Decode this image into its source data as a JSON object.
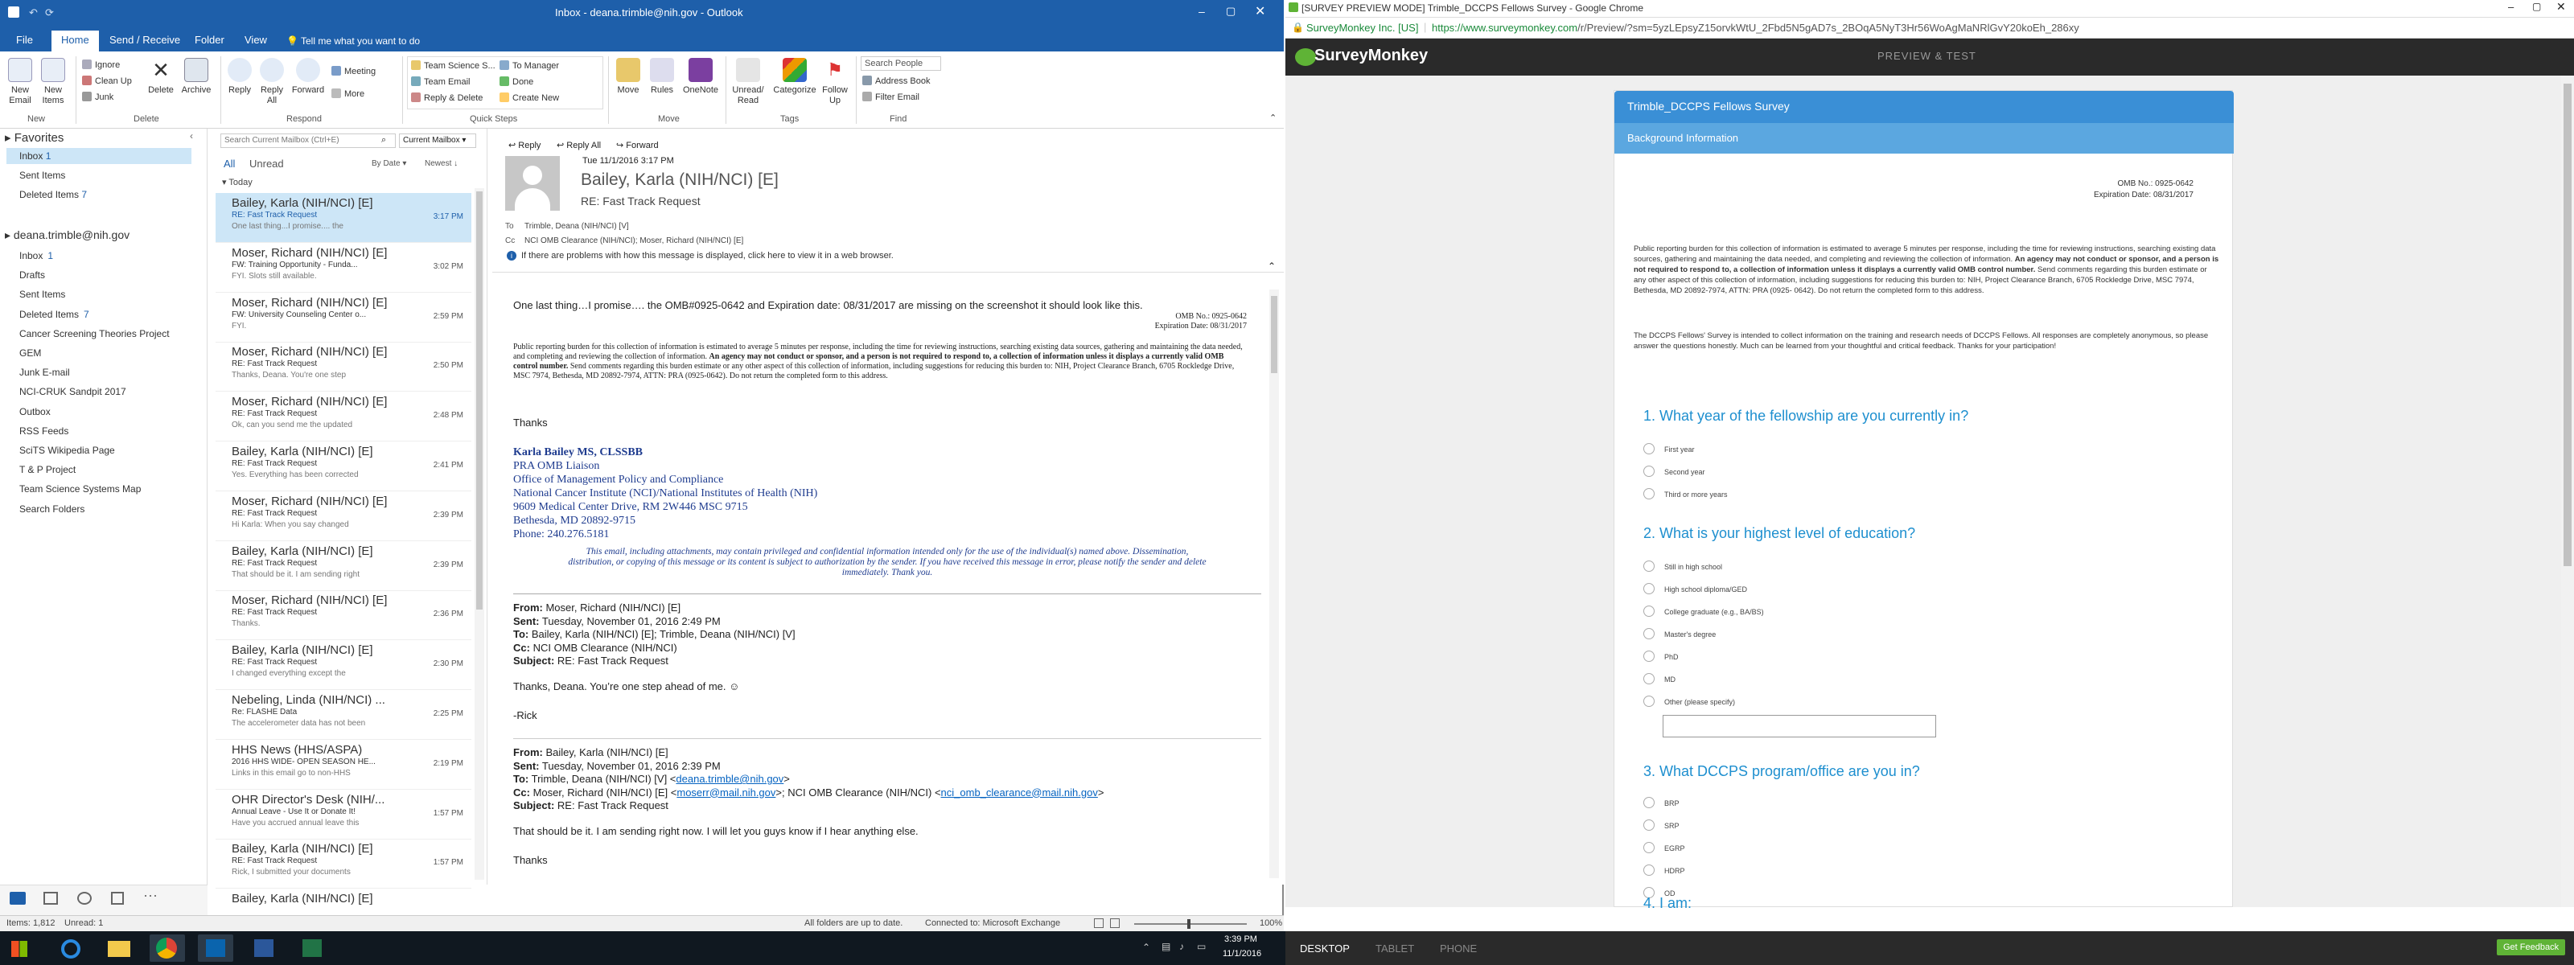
{
  "outlook": {
    "title": "Inbox - deana.trimble@nih.gov - Outlook",
    "tabs": [
      "File",
      "Home",
      "Send / Receive",
      "Folder",
      "View"
    ],
    "tellme": "Tell me what you want to do",
    "ribbon": {
      "new_email": "New Email",
      "new_items": "New Items",
      "ignore": "Ignore",
      "cleanup": "Clean Up",
      "junk": "Junk",
      "delete": "Delete",
      "archive": "Archive",
      "reply": "Reply",
      "reply_all": "Reply All",
      "forward": "Forward",
      "meeting": "Meeting",
      "more": "More",
      "qs1": "Team Science S...",
      "qs2": "Team Email",
      "qs3": "Reply & Delete",
      "qs4": "To Manager",
      "qs5": "Done",
      "qs6": "Create New",
      "move": "Move",
      "rules": "Rules",
      "onenote": "OneNote",
      "unread_read": "Unread/ Read",
      "categorize": "Categorize",
      "follow_up": "Follow Up",
      "search_people": "Search People",
      "address_book": "Address Book",
      "filter_email": "Filter Email",
      "groups": [
        "New",
        "Delete",
        "Respond",
        "Quick Steps",
        "Move",
        "Tags",
        "Find"
      ]
    },
    "favorites": {
      "header": "Favorites",
      "items": [
        {
          "label": "Inbox",
          "count": "1"
        },
        {
          "label": "Sent Items",
          "count": ""
        },
        {
          "label": "Deleted Items",
          "count": "7"
        }
      ]
    },
    "account": "deana.trimble@nih.gov",
    "folders": [
      {
        "label": "Inbox",
        "count": "1"
      },
      {
        "label": "Drafts",
        "count": ""
      },
      {
        "label": "Sent Items",
        "count": ""
      },
      {
        "label": "Deleted Items",
        "count": "7"
      },
      {
        "label": "Cancer Screening Theories Project",
        "count": ""
      },
      {
        "label": "GEM",
        "count": ""
      },
      {
        "label": "Junk E-mail",
        "count": ""
      },
      {
        "label": "NCI-CRUK Sandpit 2017",
        "count": ""
      },
      {
        "label": "Outbox",
        "count": ""
      },
      {
        "label": "RSS Feeds",
        "count": ""
      },
      {
        "label": "SciTS Wikipedia Page",
        "count": ""
      },
      {
        "label": "T & P Project",
        "count": ""
      },
      {
        "label": "Team Science Systems Map",
        "count": ""
      },
      {
        "label": "Search Folders",
        "count": ""
      }
    ],
    "search_placeholder": "Search Current Mailbox (Ctrl+E)",
    "scope": "Current Mailbox",
    "filter_all": "All",
    "filter_unread": "Unread",
    "sort_by": "By Date",
    "sort_order": "Newest",
    "group_today": "Today",
    "messages": [
      {
        "from": "Bailey, Karla (NIH/NCI) [E]",
        "subject": "RE: Fast Track Request",
        "preview": "One last thing...I promise.... the",
        "time": "3:17 PM"
      },
      {
        "from": "Moser, Richard (NIH/NCI) [E]",
        "subject": "FW: Training Opportunity - Funda...",
        "preview": "FYI.  Slots still available.",
        "time": "3:02 PM"
      },
      {
        "from": "Moser, Richard (NIH/NCI) [E]",
        "subject": "FW: University Counseling Center o...",
        "preview": "FYI.",
        "time": "2:59 PM"
      },
      {
        "from": "Moser, Richard (NIH/NCI) [E]",
        "subject": "RE: Fast Track Request",
        "preview": "Thanks, Deana.  You're one step",
        "time": "2:50 PM"
      },
      {
        "from": "Moser, Richard (NIH/NCI) [E]",
        "subject": "RE: Fast Track Request",
        "preview": "Ok, can you send me the updated",
        "time": "2:48 PM"
      },
      {
        "from": "Bailey, Karla (NIH/NCI) [E]",
        "subject": "RE: Fast Track Request",
        "preview": "Yes.  Everything has been corrected",
        "time": "2:41 PM"
      },
      {
        "from": "Moser, Richard (NIH/NCI) [E]",
        "subject": "RE: Fast Track Request",
        "preview": "Hi Karla:  When you say  changed",
        "time": "2:39 PM"
      },
      {
        "from": "Bailey, Karla (NIH/NCI) [E]",
        "subject": "RE: Fast Track Request",
        "preview": "That should be it. I am sending right",
        "time": "2:39 PM"
      },
      {
        "from": "Moser, Richard (NIH/NCI) [E]",
        "subject": "RE: Fast Track Request",
        "preview": "Thanks.",
        "time": "2:36 PM"
      },
      {
        "from": "Bailey, Karla (NIH/NCI) [E]",
        "subject": "RE: Fast Track Request",
        "preview": "I changed everything except the",
        "time": "2:30 PM"
      },
      {
        "from": "Nebeling, Linda (NIH/NCI) ...",
        "subject": "Re: FLASHE Data",
        "preview": "The accelerometer data has not been",
        "time": "2:25 PM"
      },
      {
        "from": "HHS News (HHS/ASPA)",
        "subject": "2016 HHS WIDE- OPEN SEASON HE...",
        "preview": "Links in this email go to non-HHS",
        "time": "2:19 PM"
      },
      {
        "from": "OHR Director's Desk (NIH/...",
        "subject": "Annual Leave - Use It or Donate It!",
        "preview": "Have you accrued annual leave this",
        "time": "1:57 PM"
      },
      {
        "from": "Bailey, Karla (NIH/NCI) [E]",
        "subject": "RE: Fast Track Request",
        "preview": "Rick,  I submitted your documents",
        "time": "1:57 PM"
      },
      {
        "from": "Bailey, Karla (NIH/NCI) [E]",
        "subject": "",
        "preview": "",
        "time": ""
      }
    ],
    "reading": {
      "reply": "Reply",
      "reply_all": "Reply All",
      "forward": "Forward",
      "date": "Tue 11/1/2016 3:17 PM",
      "sender": "Bailey, Karla (NIH/NCI) [E]",
      "subject": "RE: Fast Track Request",
      "to_label": "To",
      "to": "Trimble, Deana (NIH/NCI) [V]",
      "cc_label": "Cc",
      "cc": "NCI OMB Clearance (NIH/NCI); Moser, Richard (NIH/NCI) [E]",
      "info": "If there are problems with how this message is displayed, click here to view it in a web browser.",
      "line1": "One last thing…I promise…. the OMB#0925-0642 and Expiration date: 08/31/2017 are missing on the screenshot it should look like this.",
      "omb_no": "OMB No.: 0925-0642",
      "exp_date": "Expiration Date: 08/31/2017",
      "burden1": "Public reporting burden for this collection of information is estimated to average 5 minutes per response, including the time for reviewing instructions, searching existing data sources, gathering and",
      "burden2": "maintaining the data needed, and completing and reviewing the collection of information.",
      "burden3": "An agency may not conduct or sponsor, and a person is not required to respond to, a collection of",
      "burden4": "information unless it displays a currently valid OMB control number.",
      "burden5": "Send comments regarding this burden estimate or any other aspect of this collection of information, including suggestions for",
      "burden6": "reducing this burden to: NIH, Project Clearance Branch, 6705 Rockledge Drive, MSC 7974, Bethesda, MD 20892-7974, ATTN: PRA (0925-0642). Do not return the completed form to this address.",
      "thanks": "Thanks",
      "sig_name": "Karla Bailey MS, CLSSBB",
      "sig_l1": "PRA OMB Liaison",
      "sig_l2": "Office of Management Policy and Compliance",
      "sig_l3": "National Cancer Institute (NCI)/National Institutes of Health (NIH)",
      "sig_l4": "9609 Medical Center Drive, RM 2W446 MSC 9715",
      "sig_l5": "Bethesda, MD  20892-9715",
      "sig_l6": "Phone: 240.276.5181",
      "disc1": "This email, including attachments, may contain privileged and confidential information intended only for the use of the individual(s) named above. Dissemination,",
      "disc2": "distribution, or copying of this message or its content is subject to authorization by the sender. If you have received this message in error, please notify the sender and delete",
      "disc3": "immediately. Thank you.",
      "q1_from": "From:",
      "q1_from_v": "Moser, Richard (NIH/NCI) [E]",
      "q1_sent": "Sent:",
      "q1_sent_v": "Tuesday, November 01, 2016 2:49 PM",
      "q1_to": "To:",
      "q1_to_v": "Bailey, Karla (NIH/NCI) [E]; Trimble, Deana (NIH/NCI) [V]",
      "q1_cc": "Cc:",
      "q1_cc_v": "NCI OMB Clearance (NIH/NCI)",
      "q1_subj": "Subject:",
      "q1_subj_v": "RE: Fast Track Request",
      "q1_body": "Thanks, Deana.  You’re one step ahead of me. ☺",
      "q1_sig": "-Rick",
      "q2_from": "From:",
      "q2_from_v": "Bailey, Karla (NIH/NCI) [E]",
      "q2_sent": "Sent:",
      "q2_sent_v": "Tuesday, November 01, 2016 2:39 PM",
      "q2_to": "To:",
      "q2_to_v": "Trimble, Deana (NIH/NCI) [V] <",
      "q2_to_link": "deana.trimble@nih.gov",
      "q2_to_end": ">",
      "q2_cc": "Cc:",
      "q2_cc_v": "Moser, Richard (NIH/NCI) [E] <",
      "q2_cc_link1": "moserr@mail.nih.gov",
      "q2_cc_mid": ">; NCI OMB Clearance (NIH/NCI) <",
      "q2_cc_link2": "nci_omb_clearance@mail.nih.gov",
      "q2_cc_end": ">",
      "q2_subj": "Subject:",
      "q2_subj_v": "RE: Fast Track Request",
      "q2_body": "That should be it. I am sending right now. I will let you guys know if I hear anything else.",
      "q2_thanks": "Thanks"
    },
    "status": {
      "items": "Items: 1,812",
      "unread": "Unread: 1",
      "sync": "All folders are up to date.",
      "connected": "Connected to: Microsoft Exchange",
      "zoom": "100%"
    }
  },
  "chrome": {
    "title": "[SURVEY PREVIEW MODE] Trimble_DCCPS Fellows Survey - Google Chrome",
    "secure_label": "SurveyMonkey Inc. [US]",
    "url_host": "https://www.surveymonkey.com",
    "url_path": "/r/Preview/?sm=5yzLEpsyZ15orvkWtU_2Fbd5N5gAD7s_2BOqA5NyT3Hr56WoAgMaNRlGvY20koEh_286xy"
  },
  "survey": {
    "brand": "SurveyMonkey",
    "mode": "PREVIEW & TEST",
    "title": "Trimble_DCCPS Fellows Survey",
    "page_title": "Background Information",
    "omb_no": "OMB No.: 0925-0642",
    "exp_date": "Expiration Date: 08/31/2017",
    "burden_a": "Public reporting burden for this collection of information is estimated to average 5 minutes per response, including the time for reviewing instructions,",
    "burden_b": "searching existing data sources, gathering and maintaining the data needed, and completing and reviewing the collection of information.",
    "burden_c": "An agency",
    "burden_d": "may not conduct or sponsor, and a person is not required to respond to, a collection of information unless it displays a currently valid",
    "burden_e": "OMB control number.",
    "burden_f": "Send comments regarding this burden estimate or any other aspect of this collection of information, including suggestions",
    "burden_g": "for reducing this burden to: NIH, Project Clearance Branch, 6705 Rockledge Drive, MSC 7974, Bethesda, MD 20892-7974, ATTN: PRA (0925-",
    "burden_h": "0642). Do not return the completed form to this address.",
    "intro1": "The DCCPS Fellows' Survey is intended to collect information on the training and research needs of DCCPS Fellows. All responses are completely",
    "intro2": "anonymous, so please answer the questions honestly. Much can be learned from your thoughtful and critical feedback. Thanks for your",
    "intro3": "participation!",
    "q1": "1. What year of the fellowship are you currently in?",
    "q1_opts": [
      "First year",
      "Second year",
      "Third or more years"
    ],
    "q2": "2. What is your highest level of education?",
    "q2_opts": [
      "Still in high school",
      "High school diploma/GED",
      "College graduate (e.g., BA/BS)",
      "Master's degree",
      "PhD",
      "MD",
      "Other (please specify)"
    ],
    "q3": "3. What DCCPS program/office are you in?",
    "q3_opts": [
      "BRP",
      "SRP",
      "EGRP",
      "HDRP",
      "OD"
    ],
    "q4": "4. I am:",
    "footer_desktop": "DESKTOP",
    "footer_tablet": "TABLET",
    "footer_phone": "PHONE",
    "feedback": "Get Feedback"
  },
  "taskbar": {
    "time": "3:39 PM",
    "date": "11/1/2016"
  },
  "colors": {
    "outlook_blue": "#1e5faa",
    "survey_blue": "#1e8fcf",
    "monkey_green": "#5fb336"
  }
}
